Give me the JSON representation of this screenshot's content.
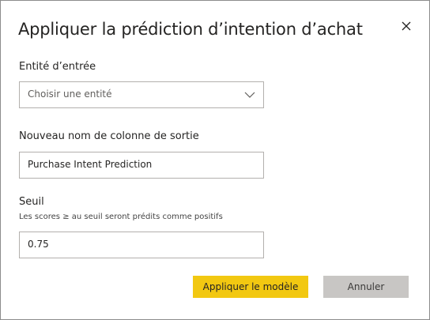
{
  "dialog": {
    "title": "Appliquer la prédiction d’intention d’achat"
  },
  "input_entity": {
    "label": "Entité d’entrée",
    "placeholder": "Choisir une entité"
  },
  "output_column": {
    "label": "Nouveau nom de colonne de sortie",
    "value": "Purchase Intent Prediction"
  },
  "threshold": {
    "label": "Seuil",
    "hint": "Les scores ≥ au seuil seront prédits comme positifs",
    "value": "0.75"
  },
  "buttons": {
    "apply_label": "Appliquer le modèle",
    "cancel_label": "Annuler"
  },
  "colors": {
    "primary_button": "#f2c811",
    "secondary_button": "#c8c6c4"
  },
  "icons": {
    "close": "close-icon",
    "dropdown": "chevron-down-icon"
  }
}
